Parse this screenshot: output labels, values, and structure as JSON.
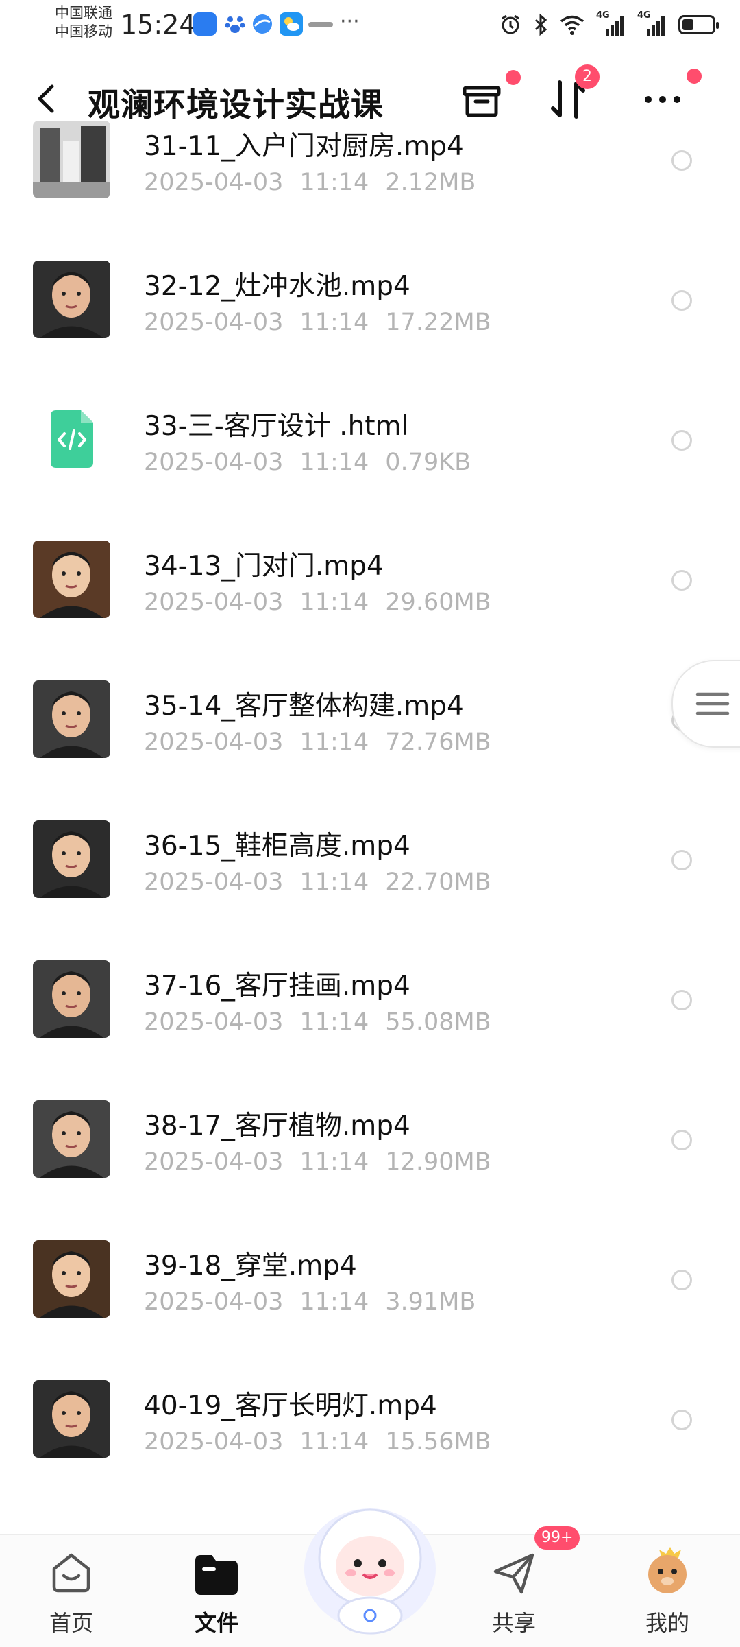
{
  "status_bar": {
    "carrier_1": "中国联通",
    "carrier_2": "中国移动",
    "time": "15:24",
    "network_1": "4G",
    "network_2": "4G"
  },
  "header": {
    "title": "观澜环境设计实战课",
    "transfer_badge": "2"
  },
  "files": [
    {
      "name": "31-11_入户门对厨房.mp4",
      "date": "2025-04-03",
      "time": "11:14",
      "size": "2.12MB",
      "type": "video"
    },
    {
      "name": "32-12_灶冲水池.mp4",
      "date": "2025-04-03",
      "time": "11:14",
      "size": "17.22MB",
      "type": "video"
    },
    {
      "name": "33-三-客厅设计 .html",
      "date": "2025-04-03",
      "time": "11:14",
      "size": "0.79KB",
      "type": "html"
    },
    {
      "name": "34-13_门对门.mp4",
      "date": "2025-04-03",
      "time": "11:14",
      "size": "29.60MB",
      "type": "video"
    },
    {
      "name": "35-14_客厅整体构建.mp4",
      "date": "2025-04-03",
      "time": "11:14",
      "size": "72.76MB",
      "type": "video"
    },
    {
      "name": "36-15_鞋柜高度.mp4",
      "date": "2025-04-03",
      "time": "11:14",
      "size": "22.70MB",
      "type": "video"
    },
    {
      "name": "37-16_客厅挂画.mp4",
      "date": "2025-04-03",
      "time": "11:14",
      "size": "55.08MB",
      "type": "video"
    },
    {
      "name": "38-17_客厅植物.mp4",
      "date": "2025-04-03",
      "time": "11:14",
      "size": "12.90MB",
      "type": "video"
    },
    {
      "name": "39-18_穿堂.mp4",
      "date": "2025-04-03",
      "time": "11:14",
      "size": "3.91MB",
      "type": "video"
    },
    {
      "name": "40-19_客厅长明灯.mp4",
      "date": "2025-04-03",
      "time": "11:14",
      "size": "15.56MB",
      "type": "video"
    }
  ],
  "bottom_nav": {
    "home": "首页",
    "files": "文件",
    "share": "共享",
    "share_badge": "99+",
    "mine": "我的"
  },
  "colors": {
    "accent_red": "#ff4d6d",
    "meta_gray": "#b4b4b4",
    "html_icon_green": "#3ecf9a"
  }
}
